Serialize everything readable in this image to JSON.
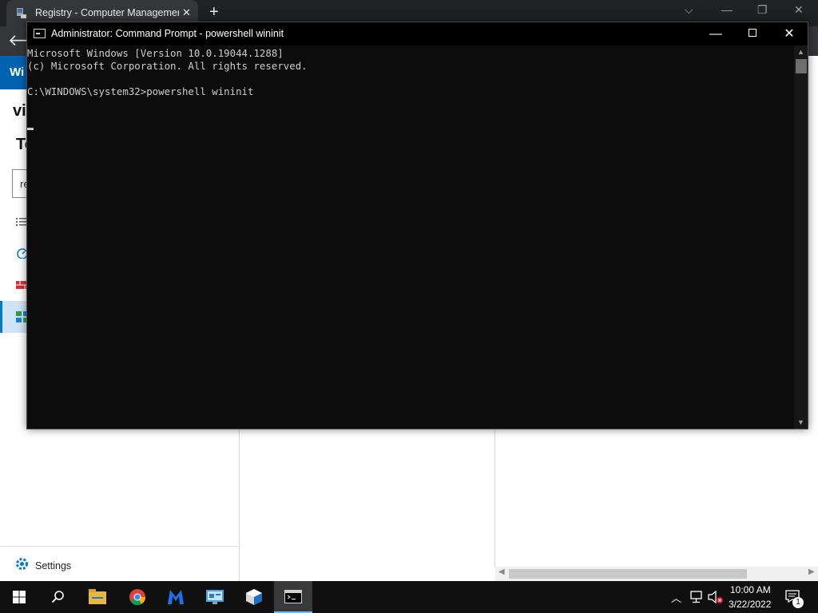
{
  "browser": {
    "tab_title": "Registry - Computer Management",
    "tab_close": "✕",
    "new_tab": "+",
    "window_controls": [
      "⌵",
      "—",
      "❐",
      "✕"
    ],
    "back": "🡐"
  },
  "background_app": {
    "header_fragment": "Wi",
    "heading_fragment": "vi",
    "subheading_fragment": "To",
    "search_fragment": "re",
    "settings_label": "Settings",
    "hscroll_left": "◀",
    "hscroll_right": "▶"
  },
  "cmd": {
    "title": "Administrator: Command Prompt - powershell  wininit",
    "controls": {
      "minimize": "—",
      "close": "✕"
    },
    "lines": [
      "Microsoft Windows [Version 10.0.19044.1288]",
      "(c) Microsoft Corporation. All rights reserved.",
      "",
      "C:\\WINDOWS\\system32>powershell wininit"
    ],
    "scroll_up": "▲",
    "scroll_down": "▼"
  },
  "taskbar": {
    "time": "10:00 AM",
    "date": "3/22/2022",
    "notification_count": "1",
    "apps": [
      "start-icon",
      "search-icon",
      "file-explorer-icon",
      "chrome-icon",
      "malwarebytes-icon",
      "control-panel-icon",
      "server-manager-icon",
      "command-prompt-icon"
    ]
  },
  "colors": {
    "accent": "#0078d4",
    "wac_header": "#0063b1",
    "console_bg": "#0c0c0c",
    "console_text": "#cccccc"
  }
}
